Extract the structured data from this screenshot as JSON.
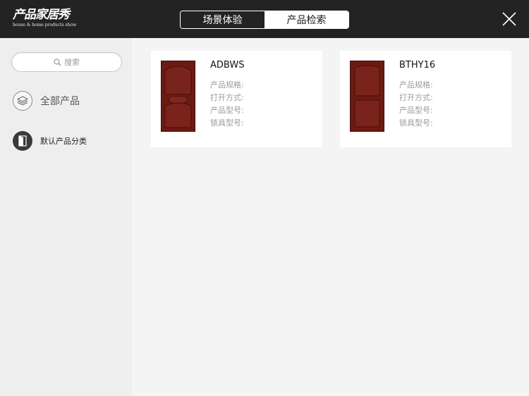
{
  "header": {
    "logo_title": "产品家居秀",
    "logo_subtitle": "house & home products show",
    "tabs": [
      {
        "label": "场景体验",
        "active": false
      },
      {
        "label": "产品检索",
        "active": true
      }
    ],
    "close_icon": "close-icon"
  },
  "sidebar": {
    "search_placeholder": "搜索",
    "all_products_label": "全部产品",
    "default_category_label": "默认产品分类"
  },
  "products": [
    {
      "name": "ADBWS",
      "spec_label": "产品规格:",
      "open_label": "打开方式:",
      "model_label": "产品型号:",
      "lock_label": "锁具型号:"
    },
    {
      "name": "BTHY16",
      "spec_label": "产品规格:",
      "open_label": "打开方式:",
      "model_label": "产品型号:",
      "lock_label": "锁具型号:"
    }
  ],
  "colors": {
    "topbar": "#232323",
    "sidebar": "#eeeeee",
    "content": "#f4f4f4",
    "door_wood": "#6b1b12"
  }
}
